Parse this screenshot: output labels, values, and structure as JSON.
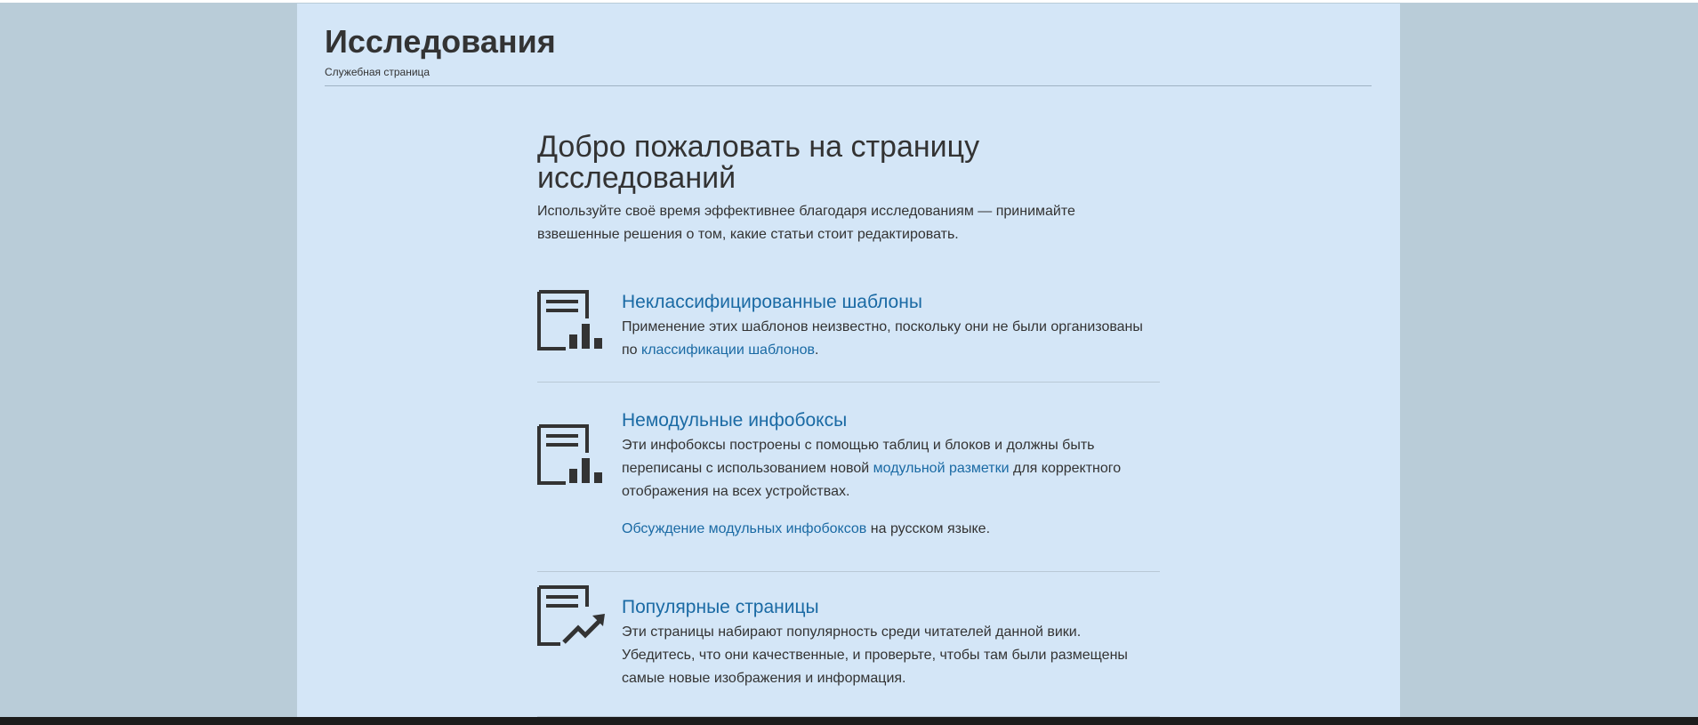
{
  "header": {
    "title": "Исследования",
    "subtitle": "Служебная страница"
  },
  "welcome": {
    "title": "Добро пожаловать на страницу исследований",
    "description": "Используйте своё время эффективнее благодаря исследованиям — принимайте взвешенные решения о том, какие статьи стоит редактировать."
  },
  "cards": [
    {
      "icon": "document-chart-icon",
      "title": "Неклассифицированные шаблоны",
      "text_before": "Применение этих шаблонов неизвестно, поскольку они не были организованы по ",
      "link": "классификации шаблонов",
      "text_after": "."
    },
    {
      "icon": "document-chart-icon",
      "title": "Немодульные инфобоксы",
      "text_before": "Эти инфобоксы построены с помощью таблиц и блоков и должны быть переписаны с использованием новой ",
      "link": "модульной разметки",
      "text_after": " для корректного отображения на всех устройствах.",
      "extra_link": "Обсуждение модульных инфобоксов",
      "extra_after": " на русском языке."
    },
    {
      "icon": "document-trend-icon",
      "title": "Популярные страницы",
      "text": "Эти страницы набирают популярность среди читателей данной вики. Убедитесь, что они качественные, и проверьте, чтобы там были размещены самые новые изображения и информация."
    }
  ],
  "colors": {
    "background": "#b9ccd8",
    "page": "#d4e6f7",
    "link": "#1a6aa4",
    "text": "#333333"
  }
}
